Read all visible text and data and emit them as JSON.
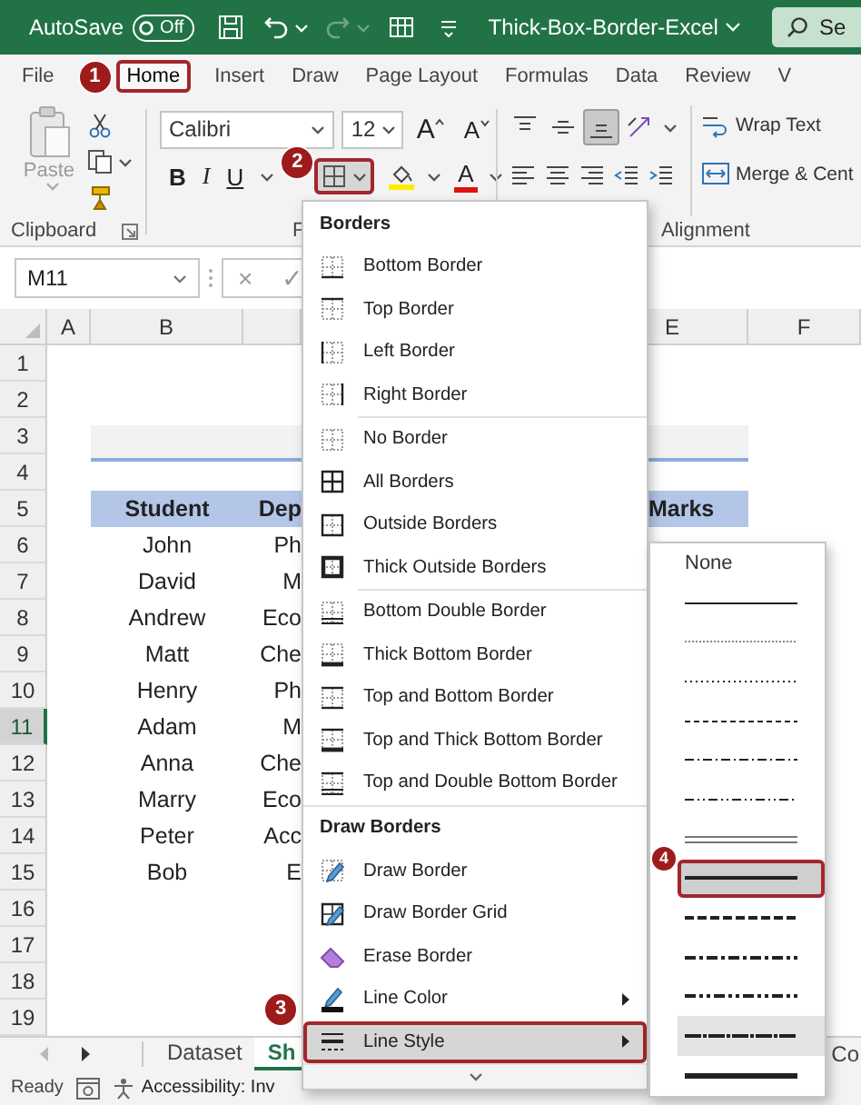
{
  "title_bar": {
    "autosave_label": "AutoSave",
    "autosave": {
      "label": "Off",
      "on": false
    },
    "title": "Thick-Box-Border-Excel",
    "search": "Se"
  },
  "ribbon_tabs": [
    {
      "label": "File",
      "selected": false
    },
    {
      "label": "Home",
      "selected": true,
      "callout": "1"
    },
    {
      "label": "Insert",
      "selected": false
    },
    {
      "label": "Draw",
      "selected": false
    },
    {
      "label": "Page Layout",
      "selected": false
    },
    {
      "label": "Formulas",
      "selected": false
    },
    {
      "label": "Data",
      "selected": false
    },
    {
      "label": "Review",
      "selected": false
    },
    {
      "label": "V",
      "selected": false
    }
  ],
  "ribbon": {
    "clipboard": {
      "paste": "Paste",
      "label": "Clipboard"
    },
    "font": {
      "name": "Calibri",
      "size": "12",
      "grow": "A",
      "shrink": "A",
      "bold": "B",
      "italic": "I",
      "underline": "U",
      "borders_callout": "2",
      "font_color": "A",
      "label": "F"
    },
    "alignment": {
      "vertical": [
        {
          "kind": "top",
          "selected": false
        },
        {
          "kind": "middle",
          "selected": false
        },
        {
          "kind": "bottom",
          "selected": true
        }
      ],
      "wrap_text": "Wrap Text",
      "merge": "Merge & Cent",
      "label": "Alignment"
    }
  },
  "formula_bar": {
    "name_box": "M11",
    "cancel": "×",
    "enter": "✓"
  },
  "sheet": {
    "column_headers": [
      "A",
      "B",
      "E",
      "F"
    ],
    "rows": [
      {
        "number": "1",
        "selected": false,
        "kind": "blank"
      },
      {
        "number": "2",
        "selected": false,
        "kind": "blank"
      },
      {
        "number": "3",
        "selected": false,
        "kind": "title_band"
      },
      {
        "number": "4",
        "selected": false,
        "kind": "blank"
      },
      {
        "number": "5",
        "selected": false,
        "kind": "header",
        "student": "Student",
        "department": "Dep",
        "marks": "Marks"
      },
      {
        "number": "6",
        "selected": false,
        "kind": "data",
        "student": "John",
        "department": "Ph"
      },
      {
        "number": "7",
        "selected": false,
        "kind": "data",
        "student": "David",
        "department": "M"
      },
      {
        "number": "8",
        "selected": false,
        "kind": "data",
        "student": "Andrew",
        "department": "Eco"
      },
      {
        "number": "9",
        "selected": false,
        "kind": "data",
        "student": "Matt",
        "department": "Che"
      },
      {
        "number": "10",
        "selected": false,
        "kind": "data",
        "student": "Henry",
        "department": "Ph"
      },
      {
        "number": "11",
        "selected": true,
        "kind": "data",
        "student": "Adam",
        "department": "M"
      },
      {
        "number": "12",
        "selected": false,
        "kind": "data",
        "student": "Anna",
        "department": "Che"
      },
      {
        "number": "13",
        "selected": false,
        "kind": "data",
        "student": "Marry",
        "department": "Eco"
      },
      {
        "number": "14",
        "selected": false,
        "kind": "data",
        "student": "Peter",
        "department": "Acc"
      },
      {
        "number": "15",
        "selected": false,
        "kind": "data",
        "student": "Bob",
        "department": "E"
      },
      {
        "number": "16",
        "selected": false,
        "kind": "blank"
      },
      {
        "number": "17",
        "selected": false,
        "kind": "blank"
      },
      {
        "number": "18",
        "selected": false,
        "kind": "blank"
      },
      {
        "number": "19",
        "selected": false,
        "kind": "blank"
      }
    ]
  },
  "borders_menu": {
    "sections": [
      {
        "title": "Borders",
        "items": [
          {
            "label": "Bottom Border",
            "kind": "bottom",
            "submenu": false,
            "selected": false
          },
          {
            "label": "Top Border",
            "kind": "top",
            "submenu": false,
            "selected": false
          },
          {
            "label": "Left Border",
            "kind": "left",
            "submenu": false,
            "selected": false
          },
          {
            "label": "Right Border",
            "kind": "right",
            "submenu": false,
            "selected": false
          }
        ]
      },
      {
        "items": [
          {
            "label": "No Border",
            "kind": "none",
            "submenu": false,
            "selected": false
          },
          {
            "label": "All Borders",
            "kind": "all",
            "submenu": false,
            "selected": false
          },
          {
            "label": "Outside Borders",
            "kind": "outside",
            "submenu": false,
            "selected": false
          },
          {
            "label": "Thick Outside Borders",
            "kind": "thick_outside",
            "submenu": false,
            "selected": false
          }
        ]
      },
      {
        "items": [
          {
            "label": "Bottom Double Border",
            "kind": "bottom_double",
            "submenu": false,
            "selected": false
          },
          {
            "label": "Thick Bottom Border",
            "kind": "thick_bottom",
            "submenu": false,
            "selected": false
          },
          {
            "label": "Top and Bottom Border",
            "kind": "top_bottom",
            "submenu": false,
            "selected": false
          },
          {
            "label": "Top and Thick Bottom Border",
            "kind": "top_thick_bottom",
            "submenu": false,
            "selected": false
          },
          {
            "label": "Top and Double Bottom Border",
            "kind": "top_double_bottom",
            "submenu": false,
            "selected": false
          }
        ]
      },
      {
        "title": "Draw Borders",
        "items": [
          {
            "label": "Draw Border",
            "kind": "draw",
            "submenu": false,
            "selected": false
          },
          {
            "label": "Draw Border Grid",
            "kind": "draw_grid",
            "submenu": false,
            "selected": false
          },
          {
            "label": "Erase Border",
            "kind": "erase",
            "submenu": false,
            "selected": false
          },
          {
            "label": "Line Color",
            "kind": "line_color",
            "submenu": true,
            "selected": false
          },
          {
            "label": "Line Style",
            "kind": "line_style",
            "submenu": true,
            "selected": true,
            "callout": "3"
          }
        ]
      }
    ]
  },
  "line_style_menu": {
    "items": [
      {
        "kind": "none",
        "label": "None",
        "selected": false,
        "highlighted": false
      },
      {
        "kind": "thin",
        "selected": false,
        "highlighted": false
      },
      {
        "kind": "hair",
        "selected": false,
        "highlighted": false
      },
      {
        "kind": "dotted",
        "selected": false,
        "highlighted": false
      },
      {
        "kind": "dashed",
        "selected": false,
        "highlighted": false
      },
      {
        "kind": "dash_dot",
        "selected": false,
        "highlighted": false
      },
      {
        "kind": "dash_dot_dot",
        "selected": false,
        "highlighted": false
      },
      {
        "kind": "double",
        "selected": false,
        "highlighted": false
      },
      {
        "kind": "medium",
        "selected": true,
        "highlighted": false,
        "callout": "4"
      },
      {
        "kind": "medium_dashed",
        "selected": false,
        "highlighted": false
      },
      {
        "kind": "medium_dash_dot",
        "selected": false,
        "highlighted": false
      },
      {
        "kind": "medium_dash_dot_dot",
        "selected": false,
        "highlighted": false
      },
      {
        "kind": "slant_dash_dot",
        "selected": false,
        "highlighted": true
      },
      {
        "kind": "thick",
        "selected": false,
        "highlighted": false
      }
    ]
  },
  "sheet_tabs": [
    {
      "label": "Dataset",
      "selected": false
    },
    {
      "label": "Sh",
      "selected": true
    }
  ],
  "sheet_tabs_right": "Co",
  "status_bar": {
    "ready": "Ready",
    "accessibility": "Accessibility: Inv"
  }
}
